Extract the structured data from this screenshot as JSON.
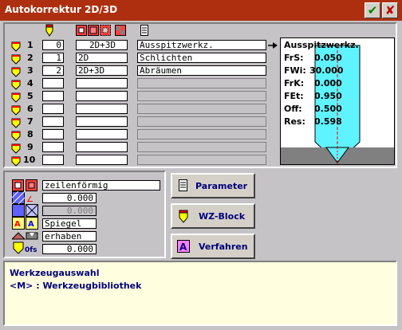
{
  "window": {
    "title": "Autokorrektur 2D/3D"
  },
  "columns": {
    "type_header": "2D+3D",
    "a": "1",
    "b": "2"
  },
  "rows": [
    {
      "num": "1",
      "val": "0",
      "mode": "2D+3D",
      "name": "Ausspitzwerkz."
    },
    {
      "num": "2",
      "val": "1",
      "mode": "2D",
      "name": "Schlichten"
    },
    {
      "num": "3",
      "val": "2",
      "mode": "2D+3D",
      "name": "Abräumen"
    },
    {
      "num": "4",
      "val": "",
      "mode": "",
      "name": ""
    },
    {
      "num": "5",
      "val": "",
      "mode": "",
      "name": ""
    },
    {
      "num": "6",
      "val": "",
      "mode": "",
      "name": ""
    },
    {
      "num": "7",
      "val": "",
      "mode": "",
      "name": ""
    },
    {
      "num": "8",
      "val": "",
      "mode": "",
      "name": ""
    },
    {
      "num": "9",
      "val": "",
      "mode": "",
      "name": ""
    },
    {
      "num": "10",
      "val": "",
      "mode": "",
      "name": ""
    }
  ],
  "detail": {
    "title": "Ausspitzwerkz.",
    "params": [
      {
        "label": "FrS:",
        "value": "0.050"
      },
      {
        "label": "FWi:",
        "value": "30.000"
      },
      {
        "label": "FrK:",
        "value": "0.000"
      },
      {
        "label": "FEt:",
        "value": "0.950"
      },
      {
        "label": "Off:",
        "value": "0.500"
      },
      {
        "label": "Res:",
        "value": "0.598"
      }
    ]
  },
  "settings": {
    "pattern": "zeilenförmig",
    "angle": "0.000",
    "disabled_value": "0.000",
    "mirror": "Spiegel",
    "raised": "erhaben",
    "offset": "0.000"
  },
  "buttons": {
    "parameter": "Parameter",
    "wz_block": "WZ-Block",
    "verfahren": "Verfahren"
  },
  "info": {
    "line1": "Werkzeugauswahl",
    "line2": "<M> : Werkzeugbibliothek"
  },
  "colors": {
    "title_bg": "#ad2f10",
    "info_bg": "#ffffe0",
    "tool_cyan": "#5ff3ff",
    "text_blue": "#00007b"
  }
}
